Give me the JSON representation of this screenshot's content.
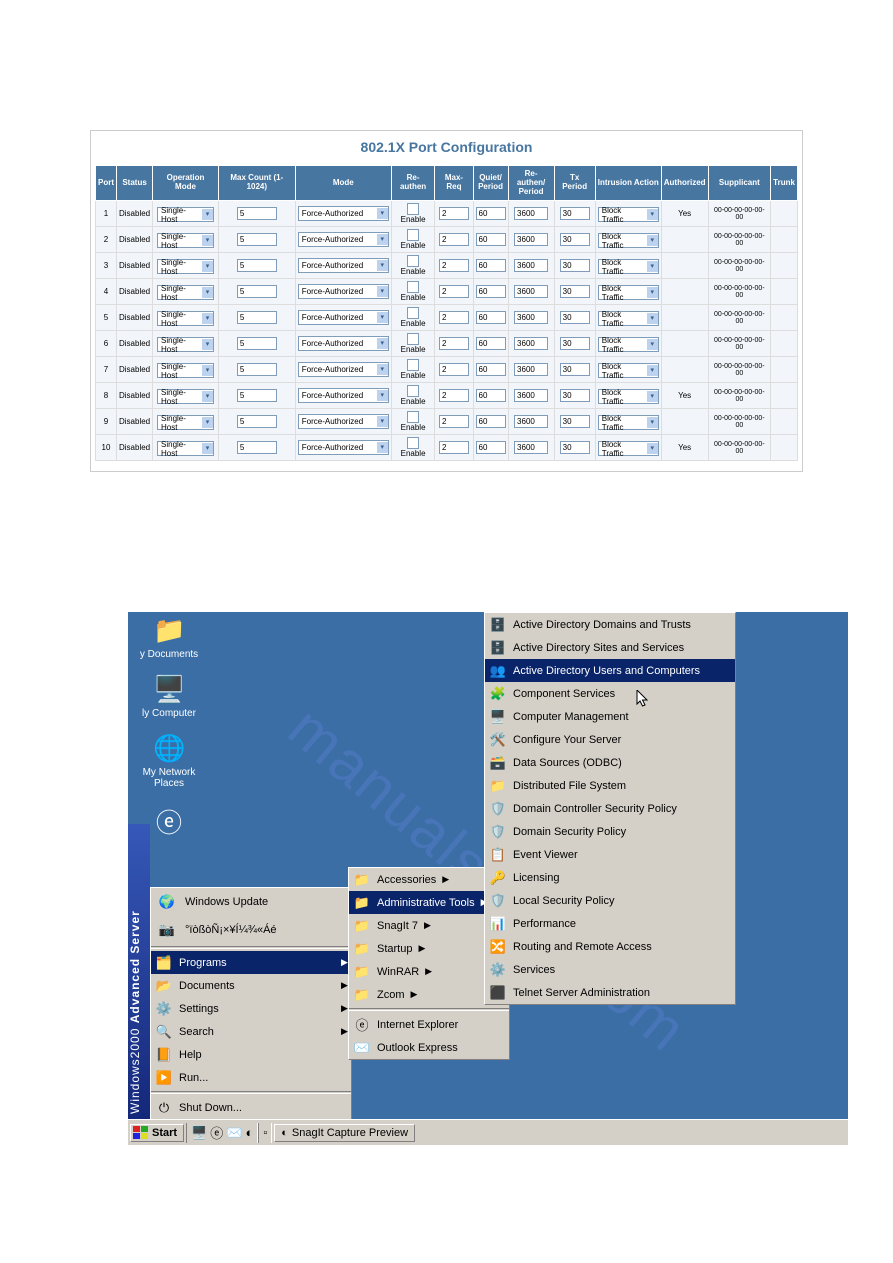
{
  "watermark": "manualshive.com",
  "port_config": {
    "title": "802.1X Port Configuration",
    "columns": [
      "Port",
      "Status",
      "Operation Mode",
      "Max Count (1-1024)",
      "Mode",
      "Re-authen",
      "Max-Req",
      "Quiet/ Period",
      "Re-authen/ Period",
      "Tx Period",
      "Intrusion Action",
      "Authorized",
      "Supplicant",
      "Trunk"
    ],
    "reauth_checkbox_label": "Enable",
    "rows": [
      {
        "port": "1",
        "status": "Disabled",
        "op_mode": "Single-Host",
        "max_count": "5",
        "mode": "Force-Authorized",
        "reauth": false,
        "max_req": "2",
        "quiet": "60",
        "reauth_period": "3600",
        "tx": "30",
        "intrusion": "Block Traffic",
        "authorized": "Yes",
        "supplicant": "00-00-00-00-00-00",
        "trunk": ""
      },
      {
        "port": "2",
        "status": "Disabled",
        "op_mode": "Single-Host",
        "max_count": "5",
        "mode": "Force-Authorized",
        "reauth": false,
        "max_req": "2",
        "quiet": "60",
        "reauth_period": "3600",
        "tx": "30",
        "intrusion": "Block Traffic",
        "authorized": "",
        "supplicant": "00-00-00-00-00-00",
        "trunk": ""
      },
      {
        "port": "3",
        "status": "Disabled",
        "op_mode": "Single-Host",
        "max_count": "5",
        "mode": "Force-Authorized",
        "reauth": false,
        "max_req": "2",
        "quiet": "60",
        "reauth_period": "3600",
        "tx": "30",
        "intrusion": "Block Traffic",
        "authorized": "",
        "supplicant": "00-00-00-00-00-00",
        "trunk": ""
      },
      {
        "port": "4",
        "status": "Disabled",
        "op_mode": "Single-Host",
        "max_count": "5",
        "mode": "Force-Authorized",
        "reauth": false,
        "max_req": "2",
        "quiet": "60",
        "reauth_period": "3600",
        "tx": "30",
        "intrusion": "Block Traffic",
        "authorized": "",
        "supplicant": "00-00-00-00-00-00",
        "trunk": ""
      },
      {
        "port": "5",
        "status": "Disabled",
        "op_mode": "Single-Host",
        "max_count": "5",
        "mode": "Force-Authorized",
        "reauth": false,
        "max_req": "2",
        "quiet": "60",
        "reauth_period": "3600",
        "tx": "30",
        "intrusion": "Block Traffic",
        "authorized": "",
        "supplicant": "00-00-00-00-00-00",
        "trunk": ""
      },
      {
        "port": "6",
        "status": "Disabled",
        "op_mode": "Single-Host",
        "max_count": "5",
        "mode": "Force-Authorized",
        "reauth": false,
        "max_req": "2",
        "quiet": "60",
        "reauth_period": "3600",
        "tx": "30",
        "intrusion": "Block Traffic",
        "authorized": "",
        "supplicant": "00-00-00-00-00-00",
        "trunk": ""
      },
      {
        "port": "7",
        "status": "Disabled",
        "op_mode": "Single-Host",
        "max_count": "5",
        "mode": "Force-Authorized",
        "reauth": false,
        "max_req": "2",
        "quiet": "60",
        "reauth_period": "3600",
        "tx": "30",
        "intrusion": "Block Traffic",
        "authorized": "",
        "supplicant": "00-00-00-00-00-00",
        "trunk": ""
      },
      {
        "port": "8",
        "status": "Disabled",
        "op_mode": "Single-Host",
        "max_count": "5",
        "mode": "Force-Authorized",
        "reauth": false,
        "max_req": "2",
        "quiet": "60",
        "reauth_period": "3600",
        "tx": "30",
        "intrusion": "Block Traffic",
        "authorized": "Yes",
        "supplicant": "00-00-00-00-00-00",
        "trunk": ""
      },
      {
        "port": "9",
        "status": "Disabled",
        "op_mode": "Single-Host",
        "max_count": "5",
        "mode": "Force-Authorized",
        "reauth": false,
        "max_req": "2",
        "quiet": "60",
        "reauth_period": "3600",
        "tx": "30",
        "intrusion": "Block Traffic",
        "authorized": "",
        "supplicant": "00-00-00-00-00-00",
        "trunk": ""
      },
      {
        "port": "10",
        "status": "Disabled",
        "op_mode": "Single-Host",
        "max_count": "5",
        "mode": "Force-Authorized",
        "reauth": false,
        "max_req": "2",
        "quiet": "60",
        "reauth_period": "3600",
        "tx": "30",
        "intrusion": "Block Traffic",
        "authorized": "Yes",
        "supplicant": "00-00-00-00-00-00",
        "trunk": ""
      }
    ]
  },
  "win": {
    "desktop_icons": [
      {
        "label": "y Documents",
        "icon": "folder-icon"
      },
      {
        "label": "ly Computer",
        "icon": "computer-icon"
      },
      {
        "label": "My Network Places",
        "icon": "network-icon"
      },
      {
        "label": "",
        "icon": "ie-icon"
      }
    ],
    "start_banner": {
      "os": "Windows",
      "ver": "2000",
      "edition": "Advanced Server"
    },
    "start_menu": [
      {
        "label": "Windows Update",
        "icon": "globe-update-icon",
        "arrow": false
      },
      {
        "label": "°ïòßòÑ¡×¥Í¼¾«Áé",
        "icon": "camera-icon",
        "arrow": false
      },
      {
        "sep": true
      },
      {
        "label": "Programs",
        "icon": "programs-icon",
        "arrow": true,
        "highlight": true
      },
      {
        "label": "Documents",
        "icon": "documents-icon",
        "arrow": true
      },
      {
        "label": "Settings",
        "icon": "settings-icon",
        "arrow": true
      },
      {
        "label": "Search",
        "icon": "search-icon",
        "arrow": true
      },
      {
        "label": "Help",
        "icon": "help-icon",
        "arrow": false
      },
      {
        "label": "Run...",
        "icon": "run-icon",
        "arrow": false
      },
      {
        "sep": true
      },
      {
        "label": "Shut Down...",
        "icon": "shutdown-icon",
        "arrow": false
      }
    ],
    "programs_menu": [
      {
        "label": "Accessories",
        "icon": "folder-icon",
        "arrow": true
      },
      {
        "label": "Administrative Tools",
        "icon": "folder-icon",
        "arrow": true,
        "highlight": true
      },
      {
        "label": "SnagIt 7",
        "icon": "folder-icon",
        "arrow": true
      },
      {
        "label": "Startup",
        "icon": "folder-icon",
        "arrow": true
      },
      {
        "label": "WinRAR",
        "icon": "folder-icon",
        "arrow": true
      },
      {
        "label": "Zcom",
        "icon": "folder-icon",
        "arrow": true
      },
      {
        "sep": true
      },
      {
        "label": "Internet Explorer",
        "icon": "ie-icon",
        "arrow": false
      },
      {
        "label": "Outlook Express",
        "icon": "outlook-icon",
        "arrow": false
      }
    ],
    "admin_tools_menu": [
      {
        "label": "Active Directory Domains and Trusts",
        "icon": "ad-icon"
      },
      {
        "label": "Active Directory Sites and Services",
        "icon": "ad-icon"
      },
      {
        "label": "Active Directory Users and Computers",
        "icon": "ad-users-icon",
        "highlight": true
      },
      {
        "label": "Component Services",
        "icon": "component-icon"
      },
      {
        "label": "Computer Management",
        "icon": "computer-mgmt-icon"
      },
      {
        "label": "Configure Your Server",
        "icon": "configure-icon"
      },
      {
        "label": "Data Sources (ODBC)",
        "icon": "odbc-icon"
      },
      {
        "label": "Distributed File System",
        "icon": "dfs-icon"
      },
      {
        "label": "Domain Controller Security Policy",
        "icon": "security-icon"
      },
      {
        "label": "Domain Security Policy",
        "icon": "security-icon"
      },
      {
        "label": "Event Viewer",
        "icon": "event-icon"
      },
      {
        "label": "Licensing",
        "icon": "licensing-icon"
      },
      {
        "label": "Local Security Policy",
        "icon": "security-icon"
      },
      {
        "label": "Performance",
        "icon": "performance-icon"
      },
      {
        "label": "Routing and Remote Access",
        "icon": "routing-icon"
      },
      {
        "label": "Services",
        "icon": "services-icon"
      },
      {
        "label": "Telnet Server Administration",
        "icon": "telnet-icon"
      }
    ],
    "taskbar": {
      "start": "Start",
      "quick_launch": [
        "desktop-ql-icon",
        "ie-ql-icon",
        "outlook-ql-icon",
        "snagit-ql-icon"
      ],
      "spacer_icons": [
        "spacer-ql-icon"
      ],
      "task": "SnagIt Capture Preview"
    }
  }
}
